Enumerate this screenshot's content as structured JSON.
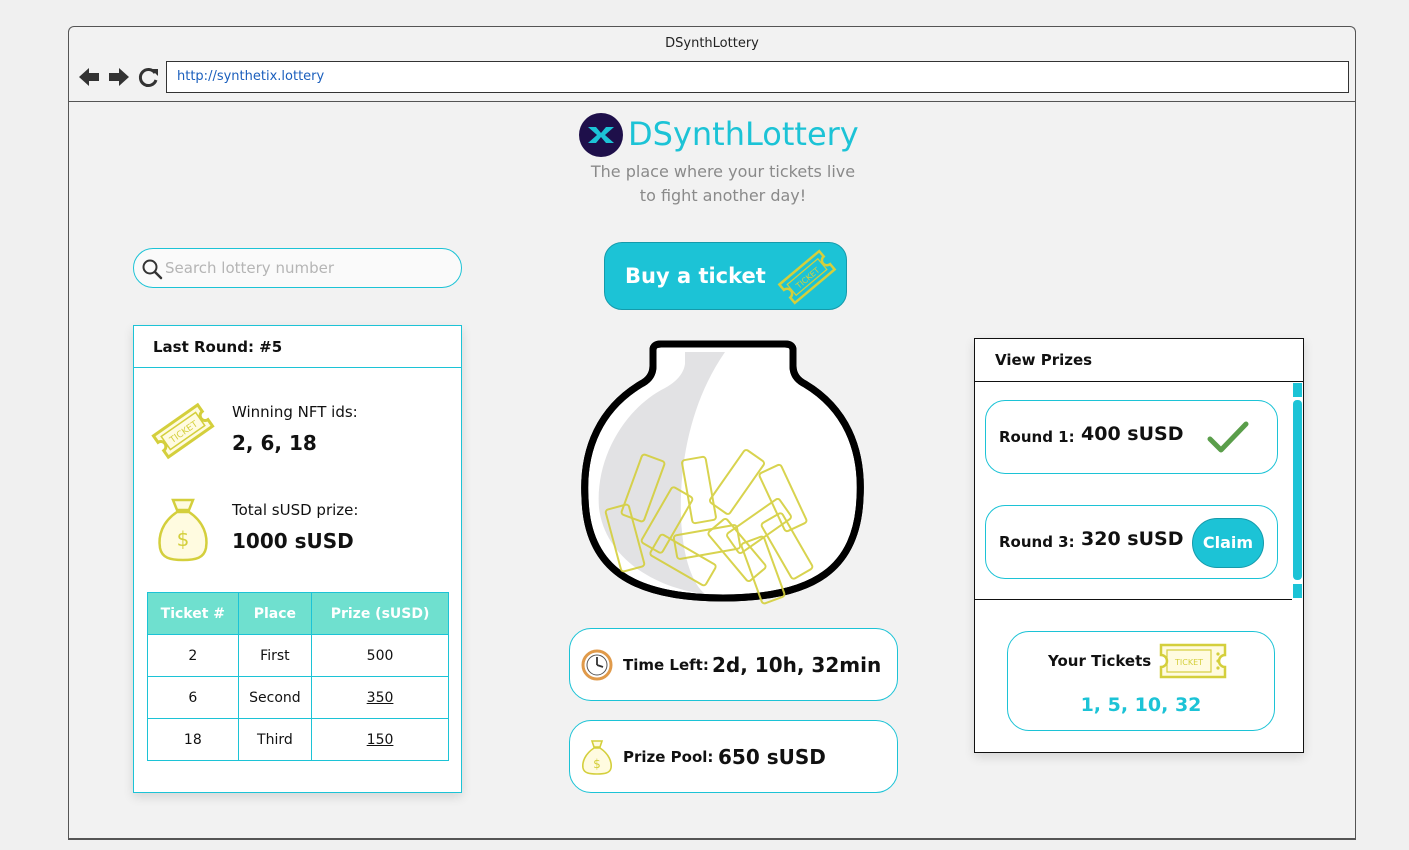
{
  "window": {
    "title": "DSynthLottery",
    "url": "http://synthetix.lottery"
  },
  "header": {
    "app_name": "DSynthLottery",
    "tagline_1": "The place where your tickets live",
    "tagline_2": "to fight another day!"
  },
  "search": {
    "placeholder": "Search lottery number",
    "value": ""
  },
  "last_round": {
    "title": "Last Round: #5",
    "winning_label": "Winning NFT ids:",
    "winning_value": "2, 6, 18",
    "prize_label": "Total sUSD prize:",
    "prize_value": "1000 sUSD",
    "table": {
      "headers": [
        "Ticket #",
        "Place",
        "Prize (sUSD)"
      ],
      "rows": [
        [
          "2",
          "First",
          "500"
        ],
        [
          "6",
          "Second",
          "350"
        ],
        [
          "18",
          "Third",
          "150"
        ]
      ]
    }
  },
  "buy": {
    "label": "Buy a ticket"
  },
  "time_left": {
    "label": "Time Left:",
    "value": "2d, 10h, 32min"
  },
  "prize_pool": {
    "label": "Prize Pool:",
    "value": "650 sUSD"
  },
  "prizes": {
    "title": "View Prizes",
    "rounds": [
      {
        "label": "Round 1:",
        "value": "400 sUSD",
        "status": "claimed"
      },
      {
        "label": "Round 3:",
        "value": "320 sUSD",
        "action": "Claim"
      }
    ]
  },
  "your_tickets": {
    "label": "Your Tickets",
    "value": "1, 5, 10, 32"
  },
  "icons": {
    "ticket_text": "TICKET",
    "ticket": "ticket-icon",
    "money_bag": "money-bag-icon",
    "clock": "clock-icon",
    "check": "check-icon",
    "search": "search-icon",
    "logo": "synthetix-logo-icon"
  },
  "colors": {
    "accent": "#1cc3d6",
    "table_header": "#6fe0cf",
    "ticket_gold": "#d4cf3c",
    "check_green": "#5a9e4a"
  }
}
